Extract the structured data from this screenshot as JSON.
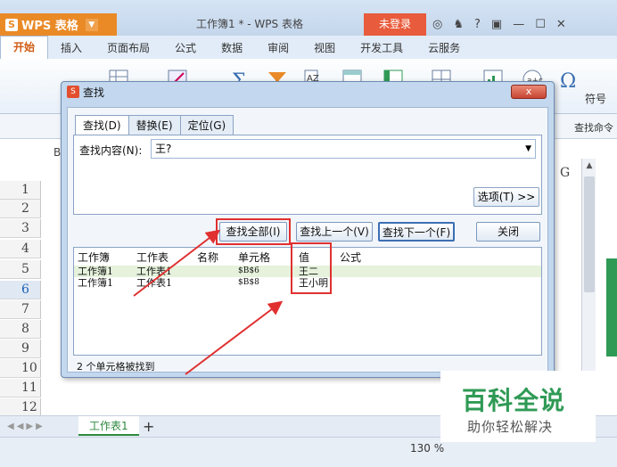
{
  "app": {
    "name": "WPS 表格",
    "doc_title": "工作簿1 * - WPS 表格",
    "login": "未登录",
    "controls_help": "?"
  },
  "menu": [
    "开始",
    "插入",
    "页面布局",
    "公式",
    "数据",
    "审阅",
    "视图",
    "开发工具",
    "云服务"
  ],
  "ribbon": {
    "symbol_label": "符号",
    "find_command": "查找命令"
  },
  "sheet": {
    "rows": [
      "1",
      "2",
      "3",
      "4",
      "5",
      "6",
      "7",
      "8",
      "9",
      "10",
      "11",
      "12"
    ],
    "selected_row": "6",
    "col_b": "B",
    "col_g": "G"
  },
  "tabs": {
    "sheet_name": "工作表1",
    "add": "+"
  },
  "status": {
    "zoom": "130 %"
  },
  "dialog": {
    "title": "查找",
    "close": "x",
    "tabs": [
      "查找(D)",
      "替换(E)",
      "定位(G)"
    ],
    "find_label": "查找内容(N):",
    "find_value": "王?",
    "options_button": "选项(T) >>",
    "buttons": {
      "find_all": "查找全部(I)",
      "find_prev": "查找上一个(V)",
      "find_next": "查找下一个(F)",
      "close": "关闭"
    },
    "result_headers": [
      "工作簿",
      "工作表",
      "名称",
      "单元格",
      "值",
      "公式"
    ],
    "results": [
      {
        "workbook": "工作簿1",
        "sheet": "工作表1",
        "name": "",
        "cell": "$B$6",
        "value": "王二",
        "formula": ""
      },
      {
        "workbook": "工作簿1",
        "sheet": "工作表1",
        "name": "",
        "cell": "$B$8",
        "value": "王小明",
        "formula": ""
      }
    ],
    "footer": "2 个单元格被找到"
  },
  "watermark": {
    "title": "百科全说",
    "subtitle": "助你轻松解决"
  },
  "colors": {
    "accent": "#e98a27",
    "highlight": "#e03030",
    "green": "#2f9a55"
  }
}
